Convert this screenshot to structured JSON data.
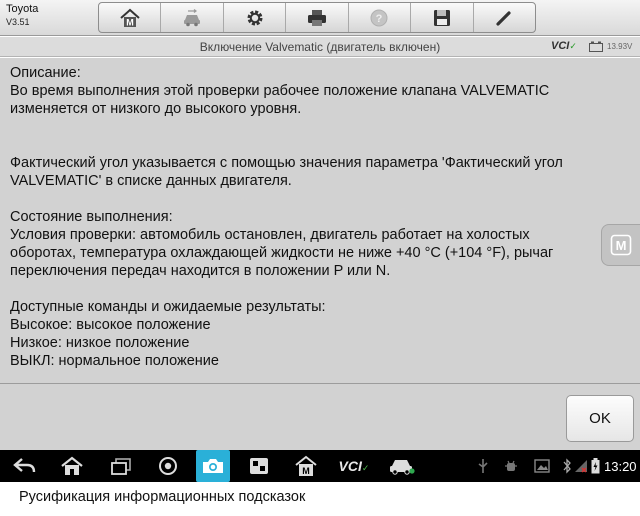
{
  "vehicle": {
    "make": "Toyota",
    "version": "V3.51"
  },
  "toolbar": {
    "buttons": [
      {
        "icon": "home-icon"
      },
      {
        "icon": "vehicle-swap-icon"
      },
      {
        "icon": "settings-gear-icon"
      },
      {
        "icon": "printer-icon"
      },
      {
        "icon": "help-icon",
        "state": "disabled"
      },
      {
        "icon": "save-icon"
      },
      {
        "icon": "edit-pencil-icon"
      }
    ]
  },
  "title_bar": {
    "title": "Включение Valvematic (двигатель включен)",
    "vci_label": "VCI",
    "voltage": "13.93V"
  },
  "content": {
    "description_heading": "Описание:",
    "description_line1": "Во время выполнения этой проверки рабочее положение клапана VALVEMATIC",
    "description_line2": "изменяется от низкого до высокого уровня.",
    "angle_line1": "Фактический угол указывается с помощью значения параметра 'Фактический угол",
    "angle_line2": "VALVEMATIC' в списке данных двигателя.",
    "status_heading": "Состояние выполнения:",
    "status_line1": "Условия проверки: автомобиль остановлен, двигатель работает на холостых",
    "status_line2": "оборотах, температура охлаждающей жидкости не ниже +40 °С (+104 °F), рычаг",
    "status_line3": "переключения передач находится в положении P или N.",
    "commands_heading": "Доступные команды и ожидаемые результаты:",
    "command_high": "Высокое: высокое положение",
    "command_low": "Низкое: низкое положение",
    "command_off": "ВЫКЛ: нормальное положение"
  },
  "actions": {
    "ok_label": "OK"
  },
  "navbar": {
    "vcl_label": "VCI",
    "time": "13:20",
    "active_color": "#2ab0d8"
  },
  "caption": "Русификация информационных подсказок"
}
